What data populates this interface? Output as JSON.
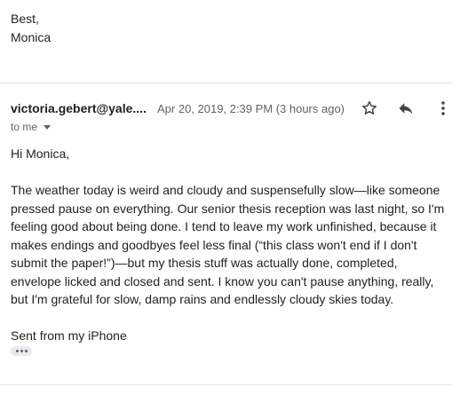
{
  "previous_message": {
    "signoff": "Best,",
    "name": "Monica"
  },
  "message": {
    "sender": "victoria.gebert@yale....",
    "date": "Apr 20, 2019, 2:39 PM (3 hours ago)",
    "to_line": "to me",
    "greeting": "Hi Monica,",
    "body_paragraph": "The weather today is weird and cloudy and suspensefully slow—like someone pressed pause on everything. Our senior thesis reception was last night, so I'm feeling good about being done. I tend to leave my work unfinished, because it makes endings and goodbyes feel less final (“this class won't end if I don't submit the paper!”)—but my thesis stuff was actually done, completed, envelope licked and closed and sent. I know you can't pause anything, really, but I'm grateful for slow, damp rains and endlessly cloudy skies today.",
    "signature": "Sent from my iPhone"
  },
  "icons": {
    "star": "star-icon",
    "reply": "reply-icon",
    "more": "more-vert-icon",
    "expand": "chevron-down-icon",
    "trimmed": "ellipsis-icon"
  },
  "colors": {
    "text": "#222222",
    "muted": "#5f6368",
    "divider": "#e5e5e5"
  }
}
